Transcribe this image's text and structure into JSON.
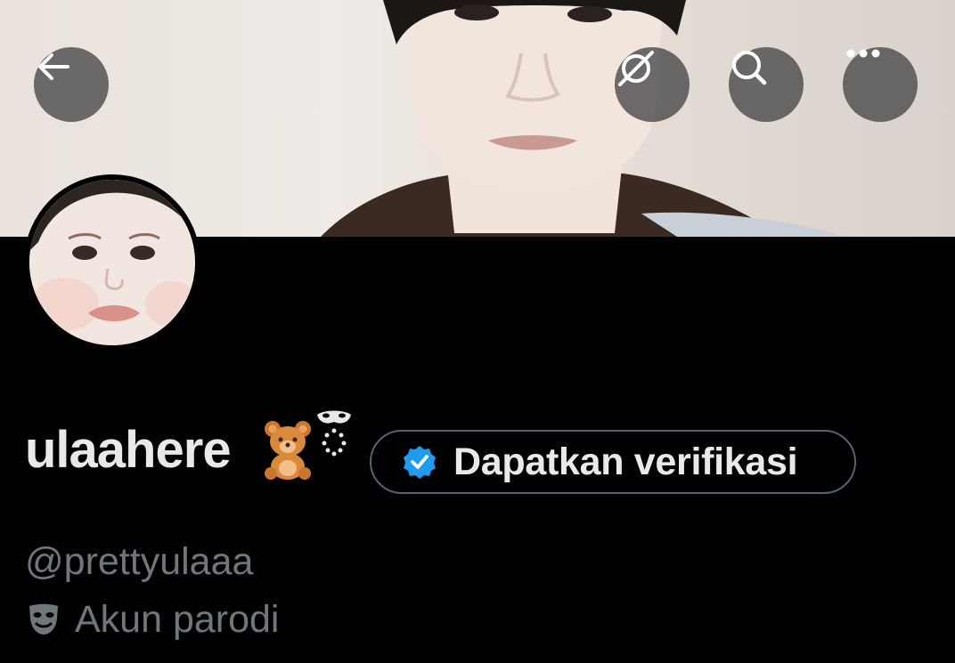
{
  "header": {
    "back_icon": "arrow-left-icon",
    "grok_icon": "grok-icon",
    "search_icon": "search-icon",
    "more_icon": "more-horizontal-icon"
  },
  "profile": {
    "display_name": "ulaahere",
    "name_emojis": [
      "🧸",
      "🎭"
    ],
    "handle": "@prettyulaaa",
    "parody_label": "Akun parodi",
    "parody_icon": "theater-mask-icon"
  },
  "verify_button": {
    "label": "Dapatkan verifikasi",
    "icon": "verified-badge-icon",
    "badge_color": "#1d9bf0"
  },
  "colors": {
    "background": "#000000",
    "primary_text": "#e7e9ea",
    "secondary_text": "#71767b",
    "border": "#536471"
  }
}
